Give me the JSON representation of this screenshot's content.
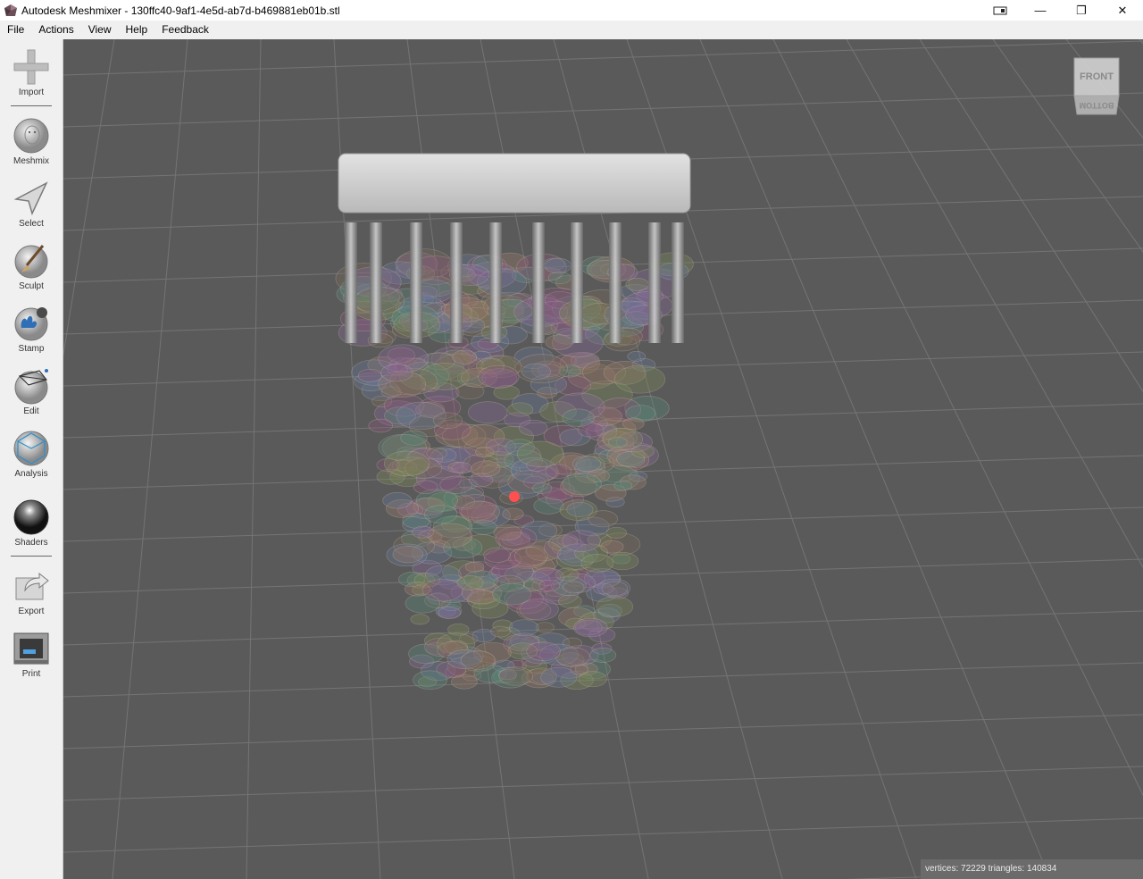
{
  "window": {
    "title": "Autodesk Meshmixer - 130ffc40-9af1-4e5d-ab7d-b469881eb01b.stl",
    "controls": {
      "minimize": "—",
      "maximize": "❐",
      "close": "✕"
    }
  },
  "menu": [
    {
      "label": "File"
    },
    {
      "label": "Actions"
    },
    {
      "label": "View"
    },
    {
      "label": "Help"
    },
    {
      "label": "Feedback"
    }
  ],
  "tools": [
    {
      "label": "Import",
      "icon": "plus-icon"
    },
    {
      "label": "Meshmix",
      "icon": "meshmix-head-icon"
    },
    {
      "label": "Select",
      "icon": "select-arrow-icon"
    },
    {
      "label": "Sculpt",
      "icon": "sculpt-brush-icon"
    },
    {
      "label": "Stamp",
      "icon": "stamp-icon"
    },
    {
      "label": "Edit",
      "icon": "edit-sphere-icon"
    },
    {
      "label": "Analysis",
      "icon": "analysis-sphere-icon"
    },
    {
      "label": "Shaders",
      "icon": "shaders-sphere-icon"
    },
    {
      "label": "Export",
      "icon": "export-icon"
    },
    {
      "label": "Print",
      "icon": "printer-icon"
    }
  ],
  "viewcube": {
    "front": "FRONT",
    "bottom": "BOTTOM"
  },
  "status": {
    "text": "vertices: 72229 triangles: 140834"
  },
  "colors": {
    "viewport_bg": "#5a5a5a",
    "pivot": "#ff4040"
  }
}
